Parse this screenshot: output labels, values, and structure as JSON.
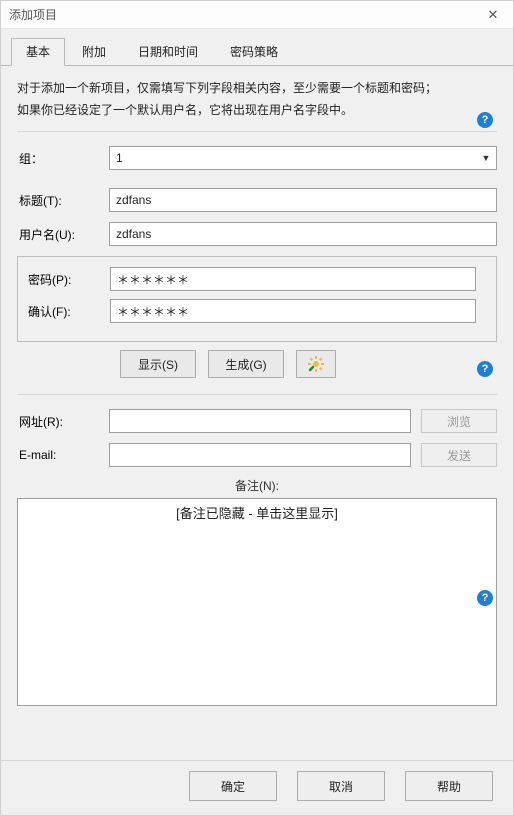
{
  "window": {
    "title": "添加项目"
  },
  "tabs": {
    "basic": "基本",
    "attach": "附加",
    "datetime": "日期和时间",
    "policy": "密码策略"
  },
  "intro": {
    "line1": "对于添加一个新项目，仅需填写下列字段相关内容，至少需要一个标题和密码；",
    "line2": "如果你已经设定了一个默认用户名，它将出现在用户名字段中。"
  },
  "labels": {
    "group": "组：",
    "title": "标题(T):",
    "username": "用户名(U):",
    "password": "密码(P):",
    "confirm": "确认(F):",
    "url": "网址(R):",
    "email": "E-mail:",
    "notes": "备注(N):"
  },
  "fields": {
    "group_value": "1",
    "title_value": "zdfans",
    "username_value": "zdfans",
    "password_value": "＊＊＊＊＊＊",
    "confirm_value": "＊＊＊＊＊＊",
    "url_value": "",
    "email_value": "",
    "notes_placeholder": "[备注已隐藏 - 单击这里显示]"
  },
  "buttons": {
    "show": "显示(S)",
    "generate": "生成(G)",
    "browse": "浏览",
    "send": "发送",
    "ok": "确定",
    "cancel": "取消",
    "help": "帮助"
  }
}
